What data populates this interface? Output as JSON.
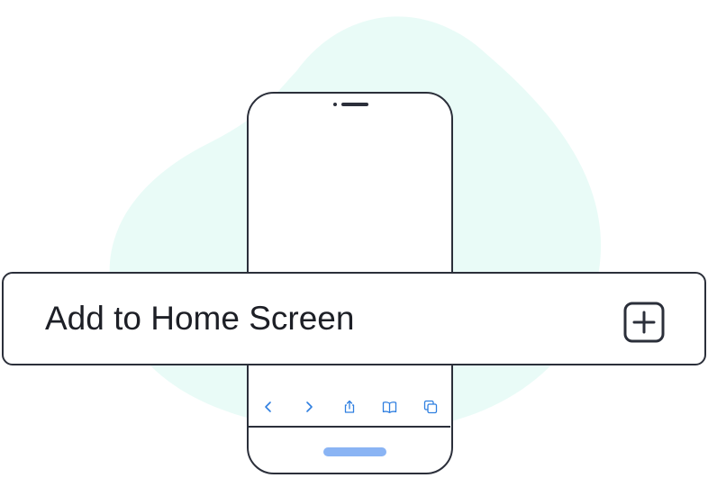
{
  "banner": {
    "label": "Add to Home Screen",
    "icon": "plus-square-icon"
  },
  "phone": {
    "toolbar": [
      {
        "name": "back",
        "icon": "chevron-left-icon"
      },
      {
        "name": "forward",
        "icon": "chevron-right-icon"
      },
      {
        "name": "share",
        "icon": "share-icon"
      },
      {
        "name": "bookmarks",
        "icon": "book-icon"
      },
      {
        "name": "tabs",
        "icon": "tabs-icon"
      }
    ]
  },
  "colors": {
    "outline": "#2b2f3a",
    "accent": "#2f7fe0",
    "blob": "#e9fbf7",
    "home_indicator": "#8ab4f4"
  }
}
